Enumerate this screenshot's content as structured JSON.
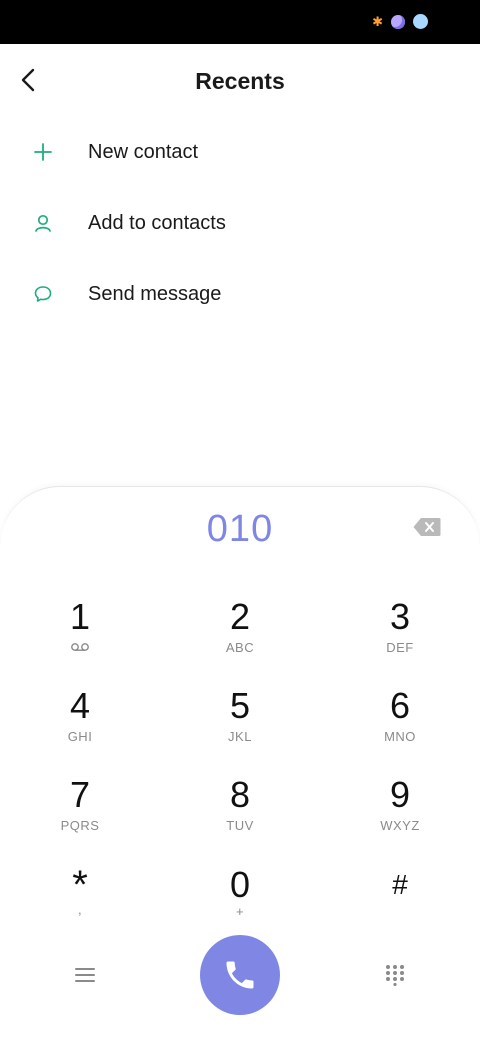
{
  "header": {
    "title": "Recents"
  },
  "actions": [
    {
      "label": "New contact",
      "icon": "plus-icon"
    },
    {
      "label": "Add to contacts",
      "icon": "person-icon"
    },
    {
      "label": "Send message",
      "icon": "message-icon"
    }
  ],
  "dialer": {
    "number": "010",
    "keys": [
      {
        "digit": "1",
        "letters": ""
      },
      {
        "digit": "2",
        "letters": "ABC"
      },
      {
        "digit": "3",
        "letters": "DEF"
      },
      {
        "digit": "4",
        "letters": "GHI"
      },
      {
        "digit": "5",
        "letters": "JKL"
      },
      {
        "digit": "6",
        "letters": "MNO"
      },
      {
        "digit": "7",
        "letters": "PQRS"
      },
      {
        "digit": "8",
        "letters": "TUV"
      },
      {
        "digit": "9",
        "letters": "WXYZ"
      },
      {
        "digit": "*",
        "letters": ","
      },
      {
        "digit": "0",
        "letters": "+"
      },
      {
        "digit": "#",
        "letters": ""
      }
    ]
  },
  "colors": {
    "accent": "#7f86e3",
    "icon_green": "#1fae7a"
  }
}
